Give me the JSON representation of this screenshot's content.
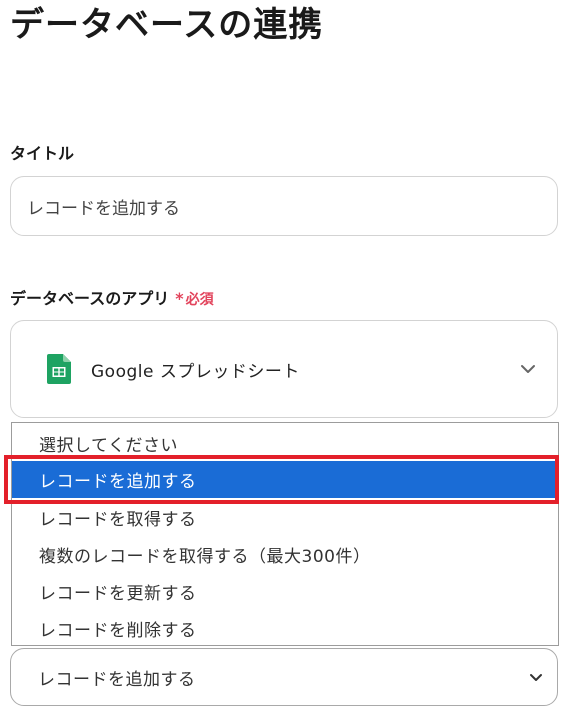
{
  "page": {
    "title": "データベースの連携"
  },
  "title_field": {
    "label": "タイトル",
    "value": "レコードを追加する"
  },
  "app_field": {
    "label": "データベースのアプリ",
    "required_mark": "*",
    "required_text": "必須",
    "selected_app": "Google スプレッドシート",
    "app_icon": "google-sheets-icon"
  },
  "action_dropdown": {
    "options": [
      "選択してください",
      "レコードを追加する",
      "レコードを取得する",
      "複数のレコードを取得する（最大300件）",
      "レコードを更新する",
      "レコードを削除する"
    ],
    "highlighted_index": 1,
    "current_value": "レコードを追加する"
  },
  "colors": {
    "selected_option_bg": "#1a6cd6",
    "annotation_box": "#e3202a",
    "required": "#e2445c",
    "sheets_green": "#1ea362"
  }
}
